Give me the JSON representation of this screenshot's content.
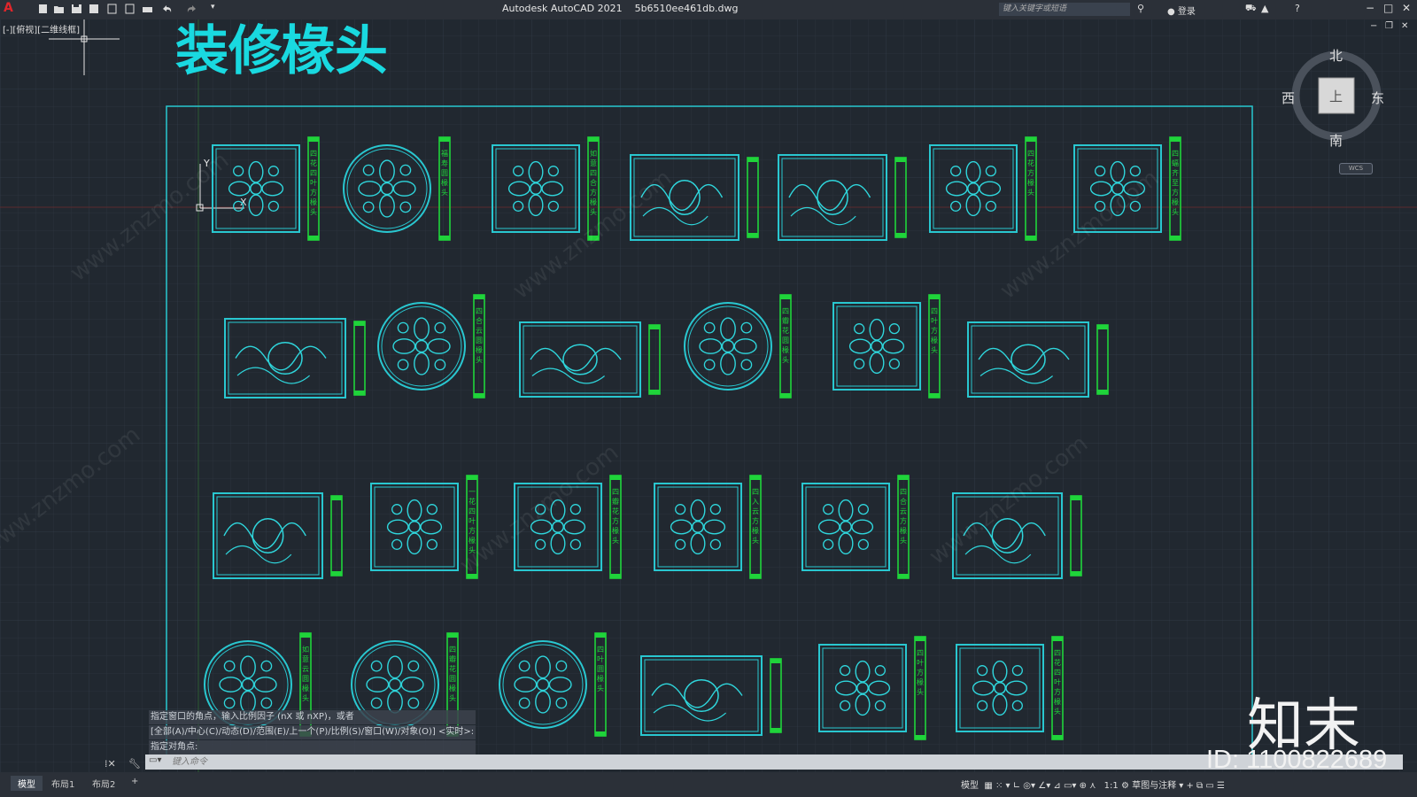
{
  "app": {
    "title": "Autodesk AutoCAD 2021    5b6510ee461db.dwg",
    "search_placeholder": "键入关键字或短语",
    "login": "登录",
    "viewport_label": "[-][俯视][二维线框]"
  },
  "drawing": {
    "title": "装修椽头",
    "colors": {
      "frame": "#29c7d0",
      "ornament": "#2fd6dc",
      "label_tag": "#1fd43a",
      "title": "#19d9e0",
      "background": "#212830"
    },
    "items": [
      {
        "shape": "square",
        "label": "四花四叶方椽头"
      },
      {
        "shape": "circle",
        "label": "福寿圆椽头"
      },
      {
        "shape": "square",
        "label": "如意四合方椽头"
      },
      {
        "shape": "rect",
        "label": ""
      },
      {
        "shape": "rect",
        "label": ""
      },
      {
        "shape": "square",
        "label": "四花方椽头"
      },
      {
        "shape": "square",
        "label": "四蝠齐至方椽头"
      },
      {
        "shape": "rect",
        "label": ""
      },
      {
        "shape": "circle",
        "label": "四合云圆椽头"
      },
      {
        "shape": "rect",
        "label": ""
      },
      {
        "shape": "circle",
        "label": "四瓣花圆椽头"
      },
      {
        "shape": "square",
        "label": "四叶方椽头"
      },
      {
        "shape": "rect",
        "label": ""
      },
      {
        "shape": "rect",
        "label": ""
      },
      {
        "shape": "square",
        "label": "一花四叶方椽头"
      },
      {
        "shape": "square",
        "label": "四瓣花方椽头"
      },
      {
        "shape": "square",
        "label": "四入云方椽头"
      },
      {
        "shape": "square",
        "label": "四合云方椽头"
      },
      {
        "shape": "rect",
        "label": ""
      },
      {
        "shape": "circle",
        "label": "如意云圆椽头"
      },
      {
        "shape": "circle",
        "label": "四瓣花圆椽头"
      },
      {
        "shape": "circle",
        "label": "四叶圆椽头"
      },
      {
        "shape": "rect",
        "label": ""
      },
      {
        "shape": "square",
        "label": "四叶方椽头"
      },
      {
        "shape": "square",
        "label": "四花四叶方椽头"
      }
    ]
  },
  "compass": {
    "north": "北",
    "south": "南",
    "east": "东",
    "west": "西",
    "top": "上",
    "wcs": "WCS"
  },
  "command": {
    "history": [
      "指定窗口的角点，输入比例因子 (nX 或 nXP)，或者",
      "[全部(A)/中心(C)/动态(D)/范围(E)/上一个(P)/比例(S)/窗口(W)/对象(O)] <实时>:",
      "指定对角点:"
    ],
    "input_placeholder": "键入命令"
  },
  "tabs": [
    "模型",
    "布局1",
    "布局2",
    "+"
  ],
  "status": {
    "model": "模型",
    "scale": "1:1",
    "workspace": "草图与注释"
  },
  "watermark": {
    "brand": "知末",
    "id": "ID: 1100822689",
    "site": "www.znzmo.com"
  }
}
